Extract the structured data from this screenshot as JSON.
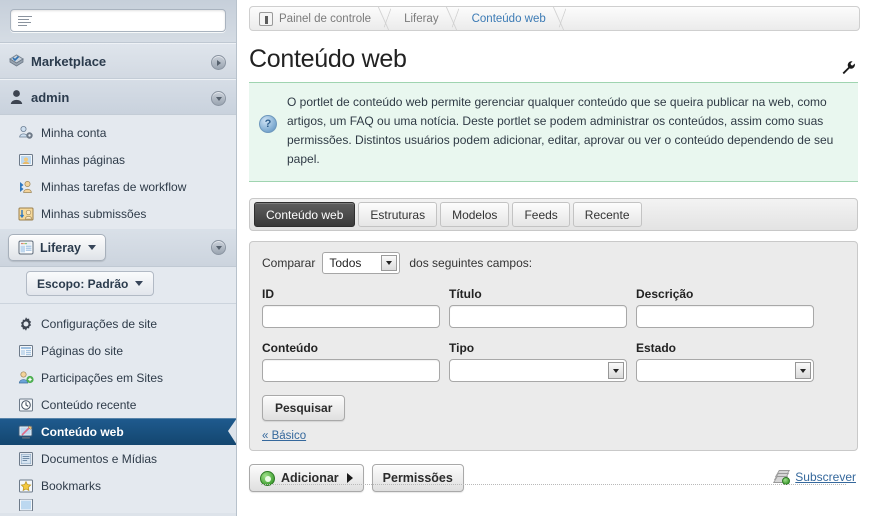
{
  "sidebar": {
    "search": {
      "value": "",
      "placeholder": ""
    },
    "marketplace": {
      "label": "Marketplace"
    },
    "user": {
      "label": "admin"
    },
    "user_items": [
      {
        "label": "Minha conta",
        "icon": "user-gear-icon"
      },
      {
        "label": "Minhas páginas",
        "icon": "pages-icon"
      },
      {
        "label": "Minhas tarefas de workflow",
        "icon": "workflow-icon"
      },
      {
        "label": "Minhas submissões",
        "icon": "submissions-icon"
      }
    ],
    "site": {
      "label": "Liferay",
      "icon": "site-icon"
    },
    "scope": {
      "label": "Escopo: Padrão"
    },
    "site_items": [
      {
        "label": "Configurações de site",
        "icon": "gear-icon",
        "selected": false
      },
      {
        "label": "Páginas do site",
        "icon": "pages-icon",
        "selected": false
      },
      {
        "label": "Participações em Sites",
        "icon": "membership-icon",
        "selected": false
      },
      {
        "label": "Conteúdo recente",
        "icon": "clock-icon",
        "selected": false
      },
      {
        "label": "Conteúdo web",
        "icon": "web-content-icon",
        "selected": true
      },
      {
        "label": "Documentos e Mídias",
        "icon": "documents-icon",
        "selected": false
      },
      {
        "label": "Bookmarks",
        "icon": "star-icon",
        "selected": false
      }
    ]
  },
  "breadcrumb": {
    "items": [
      {
        "label": "Painel de controle",
        "active": false
      },
      {
        "label": "Liferay",
        "active": false
      },
      {
        "label": "Conteúdo web",
        "active": true
      }
    ]
  },
  "header": {
    "title": "Conteúdo web",
    "wrench_icon": "wrench-icon"
  },
  "info": {
    "icon": "help-question-icon",
    "text": "O portlet de conteúdo web permite gerenciar qualquer conteúdo que se queira publicar na web, como artigos, um FAQ ou uma notícia. Deste portlet se podem administrar os conteúdos, assim como suas permissões. Distintos usuários podem adicionar, editar, aprovar ou ver o conteúdo dependendo de seu papel."
  },
  "tabs": [
    {
      "label": "Conteúdo web",
      "active": true
    },
    {
      "label": "Estruturas",
      "active": false
    },
    {
      "label": "Modelos",
      "active": false
    },
    {
      "label": "Feeds",
      "active": false
    },
    {
      "label": "Recente",
      "active": false
    }
  ],
  "search_panel": {
    "compare_label": "Comparar",
    "compare_value": "Todos",
    "compare_tail": "dos seguintes campos:",
    "row1": [
      {
        "label": "ID",
        "type": "text",
        "value": ""
      },
      {
        "label": "Título",
        "type": "text",
        "value": ""
      },
      {
        "label": "Descrição",
        "type": "text",
        "value": ""
      }
    ],
    "row2": [
      {
        "label": "Conteúdo",
        "type": "text",
        "value": ""
      },
      {
        "label": "Tipo",
        "type": "select",
        "value": ""
      },
      {
        "label": "Estado",
        "type": "select",
        "value": ""
      }
    ],
    "search_button": "Pesquisar",
    "basic_link": "« Básico"
  },
  "actions": {
    "add_label": "Adicionar",
    "add_icon": "add-circle-icon",
    "permissions_label": "Permissões",
    "subscribe_label": "Subscrever",
    "subscribe_icon": "subscribe-icon"
  },
  "colors": {
    "accent_blue": "#35689c",
    "selected_nav": "#16496f",
    "info_bg": "#e9f7ef",
    "info_border": "#9fd4b0",
    "sidebar_bg": "#dde3ea"
  }
}
